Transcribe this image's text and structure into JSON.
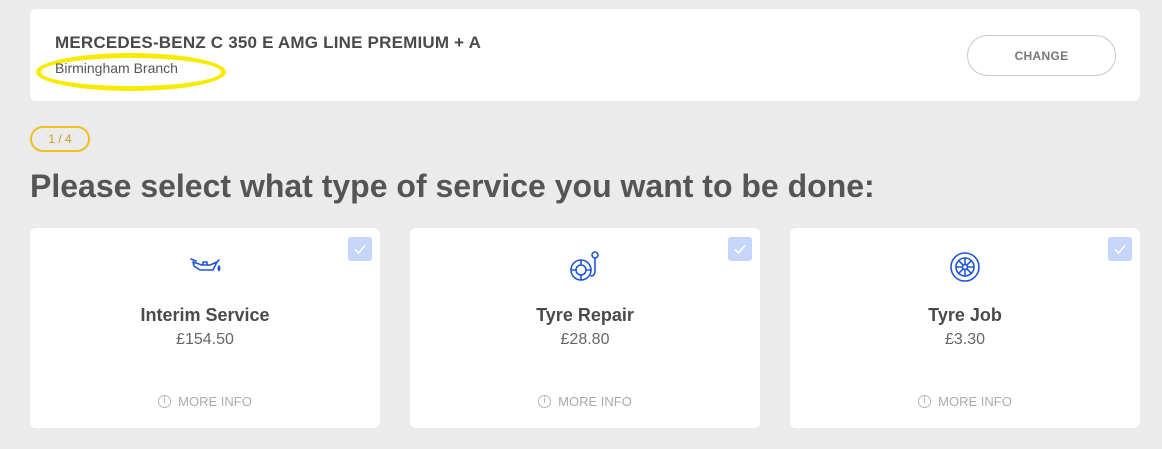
{
  "vehicle": {
    "name": "MERCEDES-BENZ C 350 E AMG LINE PREMIUM + A",
    "branch": "Birmingham Branch",
    "change_label": "CHANGE"
  },
  "step": {
    "label": "1 / 4"
  },
  "title": "Please select what type of service you want to be done:",
  "services": [
    {
      "name": "Interim Service",
      "price": "£154.50",
      "more_info": "MORE INFO",
      "icon": "oil-can-icon"
    },
    {
      "name": "Tyre Repair",
      "price": "£28.80",
      "more_info": "MORE INFO",
      "icon": "tyre-pump-icon"
    },
    {
      "name": "Tyre Job",
      "price": "£3.30",
      "more_info": "MORE INFO",
      "icon": "tyre-icon"
    }
  ],
  "colors": {
    "accent": "#2356d6",
    "highlight": "#f7ec00",
    "badge": "#f0c020",
    "checkbox": "#c5d6fa"
  }
}
